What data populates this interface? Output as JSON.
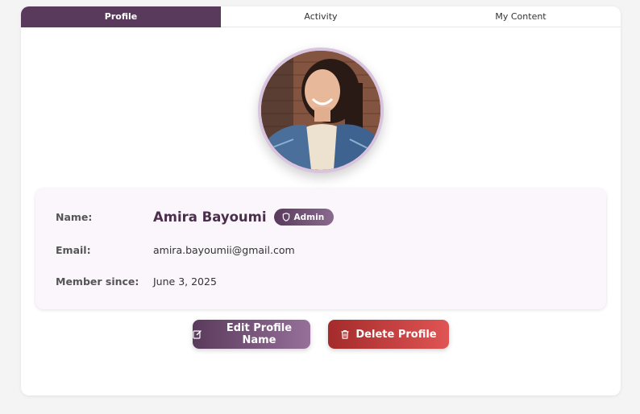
{
  "tabs": [
    {
      "label": "Profile",
      "active": true
    },
    {
      "label": "Activity",
      "active": false
    },
    {
      "label": "My Content",
      "active": false
    }
  ],
  "profile": {
    "name_label": "Name:",
    "name": "Amira Bayoumi",
    "role_badge": "Admin",
    "email_label": "Email:",
    "email": "amira.bayoumii@gmail.com",
    "member_label": "Member since:",
    "member_since": "June 3, 2025"
  },
  "actions": {
    "edit_label": "Edit Profile Name",
    "delete_label": "Delete Profile"
  },
  "colors": {
    "accent": "#5a3a5c",
    "danger": "#c03a3a",
    "avatar_ring": "#d8c4de"
  },
  "icons": {
    "badge": "shield-icon",
    "edit": "edit-icon",
    "delete": "trash-icon"
  }
}
